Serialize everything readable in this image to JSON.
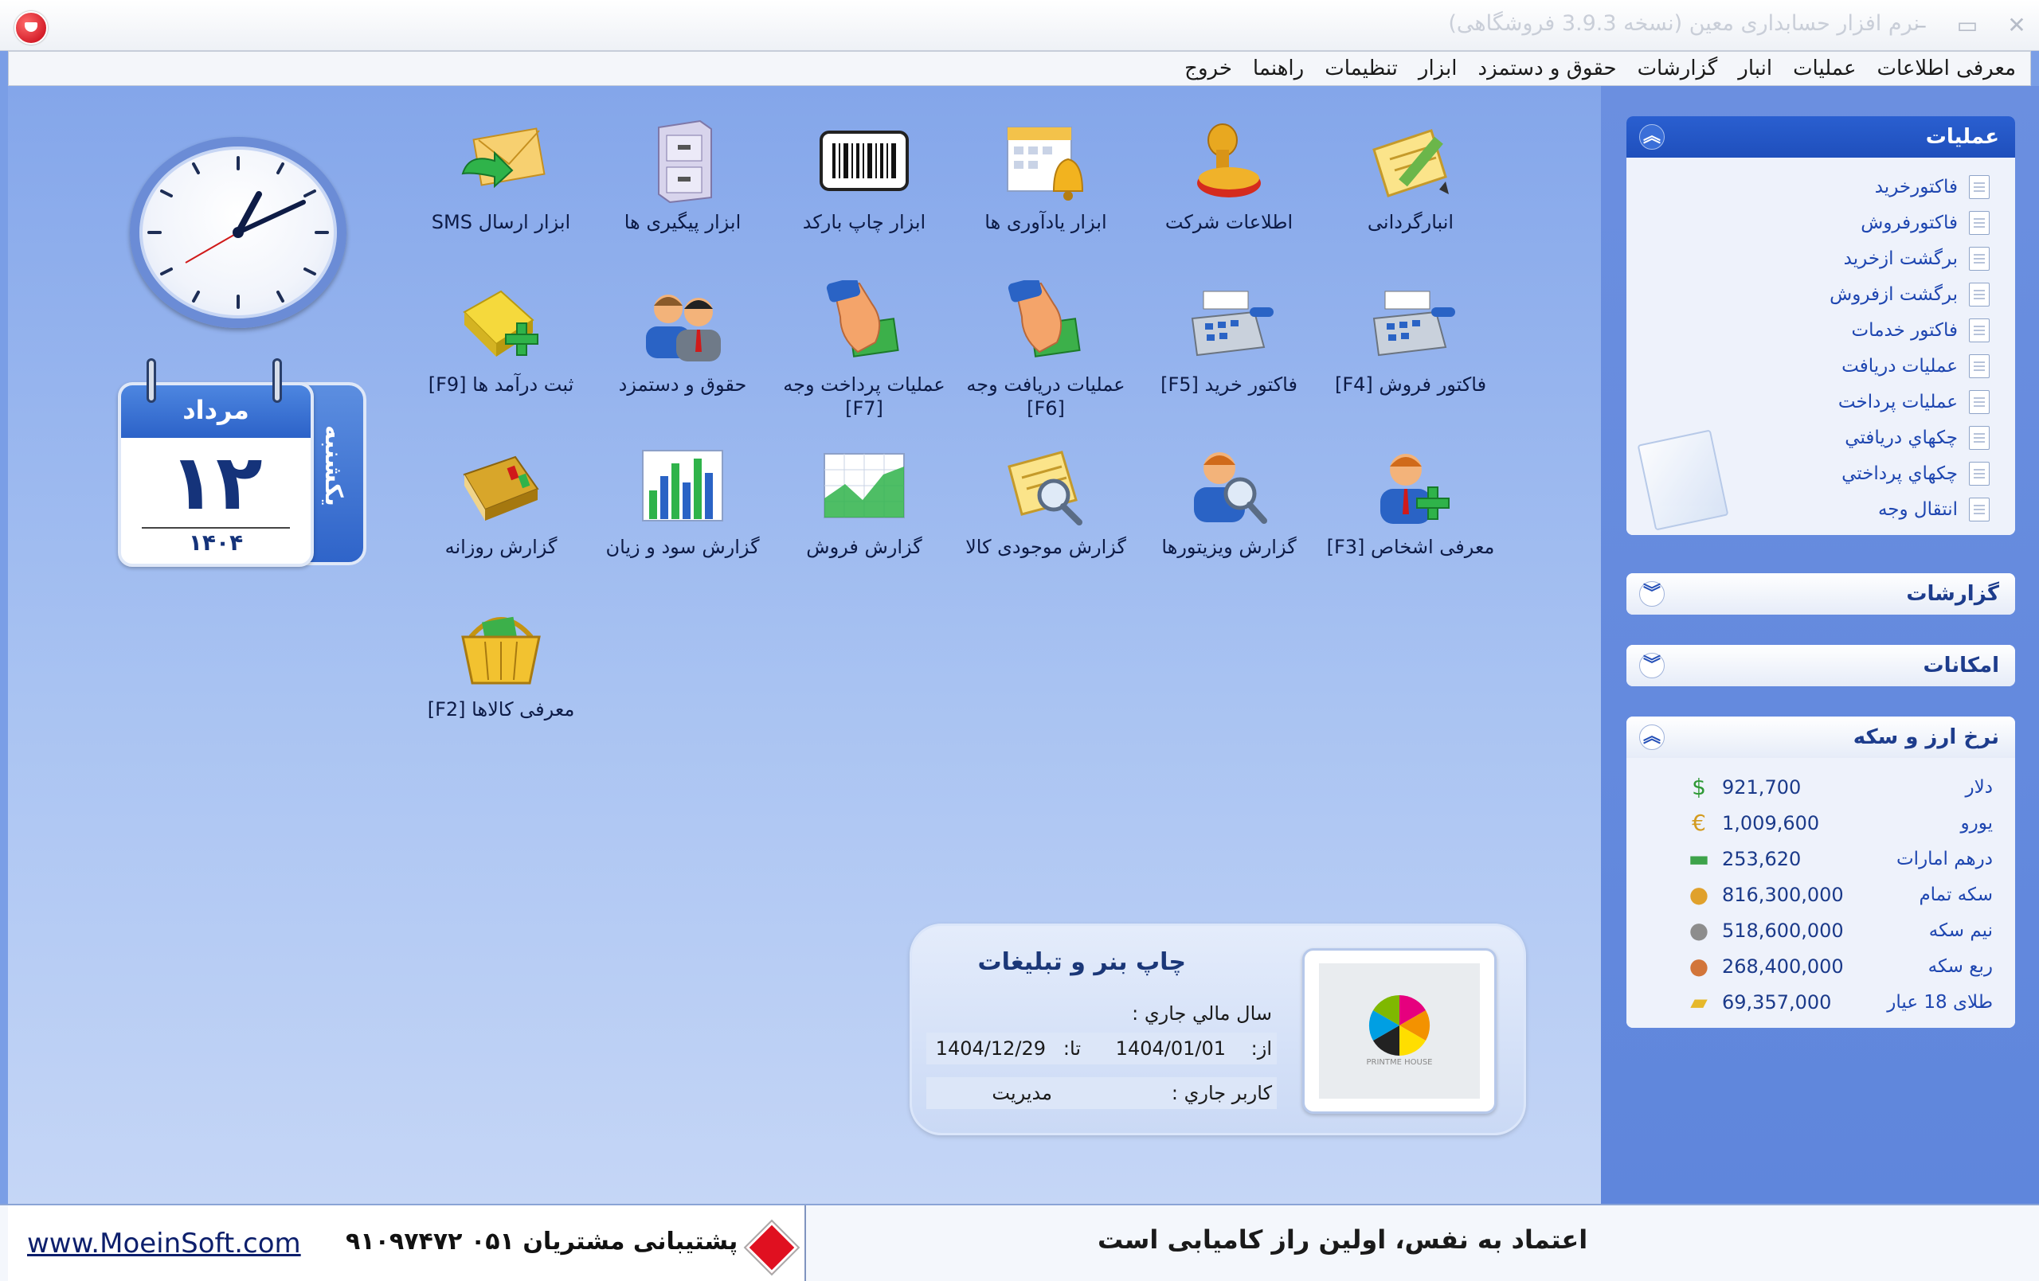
{
  "window": {
    "title": "نرم افزار حسابداری معین (نسخه 3.9.3 فروشگاهی)",
    "controls": {
      "minimize": "–",
      "maximize": "▭",
      "close": "✕"
    }
  },
  "menu": [
    "معرفی اطلاعات",
    "عملیات",
    "انبار",
    "گزارشات",
    "حقوق و دستمزد",
    "ابزار",
    "تنظیمات",
    "راهنما",
    "خروج"
  ],
  "calendar": {
    "month": "مرداد",
    "day": "۱۲",
    "year": "۱۴۰۴",
    "weekday": "یکشنبه"
  },
  "tiles": [
    {
      "label": "انبارگردانی",
      "icon": "inventory-pencil-icon"
    },
    {
      "label": "اطلاعات شرکت",
      "icon": "stamp-icon"
    },
    {
      "label": "ابزار یادآوری ها",
      "icon": "reminder-bell-icon"
    },
    {
      "label": "ابزار چاپ بارکد",
      "icon": "barcode-icon"
    },
    {
      "label": "ابزار پیگیری ها",
      "icon": "filing-cabinet-icon"
    },
    {
      "label": "ابزار ارسال SMS",
      "icon": "sms-envelope-icon"
    },
    {
      "label": "فاکتور فروش [F4]",
      "icon": "cash-register-icon"
    },
    {
      "label": "فاکتور خرید [F5]",
      "icon": "cash-register-icon"
    },
    {
      "label": "عملیات دریافت وجه [F6]",
      "icon": "hand-money-icon"
    },
    {
      "label": "عملیات پرداخت وجه [F7]",
      "icon": "hand-money-icon"
    },
    {
      "label": "حقوق و دستمزد",
      "icon": "employees-icon"
    },
    {
      "label": "ثبت درآمد ها [F9]",
      "icon": "gold-bar-plus-icon"
    },
    {
      "label": "معرفی اشخاص [F3]",
      "icon": "person-add-icon"
    },
    {
      "label": "گزارش ویزیتورها",
      "icon": "person-search-icon"
    },
    {
      "label": "گزارش موجودی کالا",
      "icon": "inventory-search-icon"
    },
    {
      "label": "گزارش فروش",
      "icon": "sales-chart-icon"
    },
    {
      "label": "گزارش سود و زیان",
      "icon": "bar-chart-icon"
    },
    {
      "label": "گزارش روزانه",
      "icon": "daily-book-icon"
    },
    {
      "label": "معرفی کالاها [F2]",
      "icon": "shopping-basket-icon"
    }
  ],
  "panels": {
    "operations": {
      "title": "عملیات",
      "items": [
        "فاکتورخرید",
        "فاکتورفروش",
        "برگشت ازخرید",
        "برگشت ازفروش",
        "فاکتور خدمات",
        "عملیات دریافت",
        "عملیات پرداخت",
        "چکهاي دريافتي",
        "چکهاي پرداختي",
        "انتقال وجه"
      ]
    },
    "reports": {
      "title": "گزارشات"
    },
    "features": {
      "title": "امکانات"
    },
    "rates": {
      "title": "نرخ ارز و سکه",
      "items": [
        {
          "name": "دلار",
          "value": "921,700",
          "icon": "dollar-icon",
          "glyph": "$",
          "color": "#2f9a36"
        },
        {
          "name": "یورو",
          "value": "1,009,600",
          "icon": "euro-icon",
          "glyph": "€",
          "color": "#d39b1f"
        },
        {
          "name": "درهم امارات",
          "value": "253,620",
          "icon": "banknote-icon",
          "glyph": "▬",
          "color": "#3da34a"
        },
        {
          "name": "سکه تمام",
          "value": "816,300,000",
          "icon": "gold-coin-icon",
          "glyph": "●",
          "color": "#e0a12c"
        },
        {
          "name": "نیم سکه",
          "value": "518,600,000",
          "icon": "silver-coin-icon",
          "glyph": "●",
          "color": "#8d8d8d"
        },
        {
          "name": "ربع سکه",
          "value": "268,400,000",
          "icon": "copper-coin-icon",
          "glyph": "●",
          "color": "#d2753a"
        },
        {
          "name": "طلای 18 عیار",
          "value": "69,357,000",
          "icon": "gold-bar-icon",
          "glyph": "▰",
          "color": "#e6b82a"
        }
      ]
    }
  },
  "info": {
    "company": "چاپ بنر و تبلیغات",
    "fiscal_year_label": "سال مالي جاري :",
    "from_label": "از:",
    "from_value": "1404/01/01",
    "to_label": "تا:",
    "to_value": "1404/12/29",
    "user_label": "کاربر جاري :",
    "user_value": "مدیریت",
    "logo_watermark": "PRINTME HOUSE"
  },
  "status": {
    "website": "www.MoeinSoft.com",
    "support": "پشتیبانی مشتریان ۰۵۱ ۹۱۰۹۷۴۷۲",
    "quote": "اعتماد به نفس، اولین راز کامیابی است"
  },
  "colors": {
    "accent": "#2a5fd0",
    "background": "#7a9ee6"
  }
}
